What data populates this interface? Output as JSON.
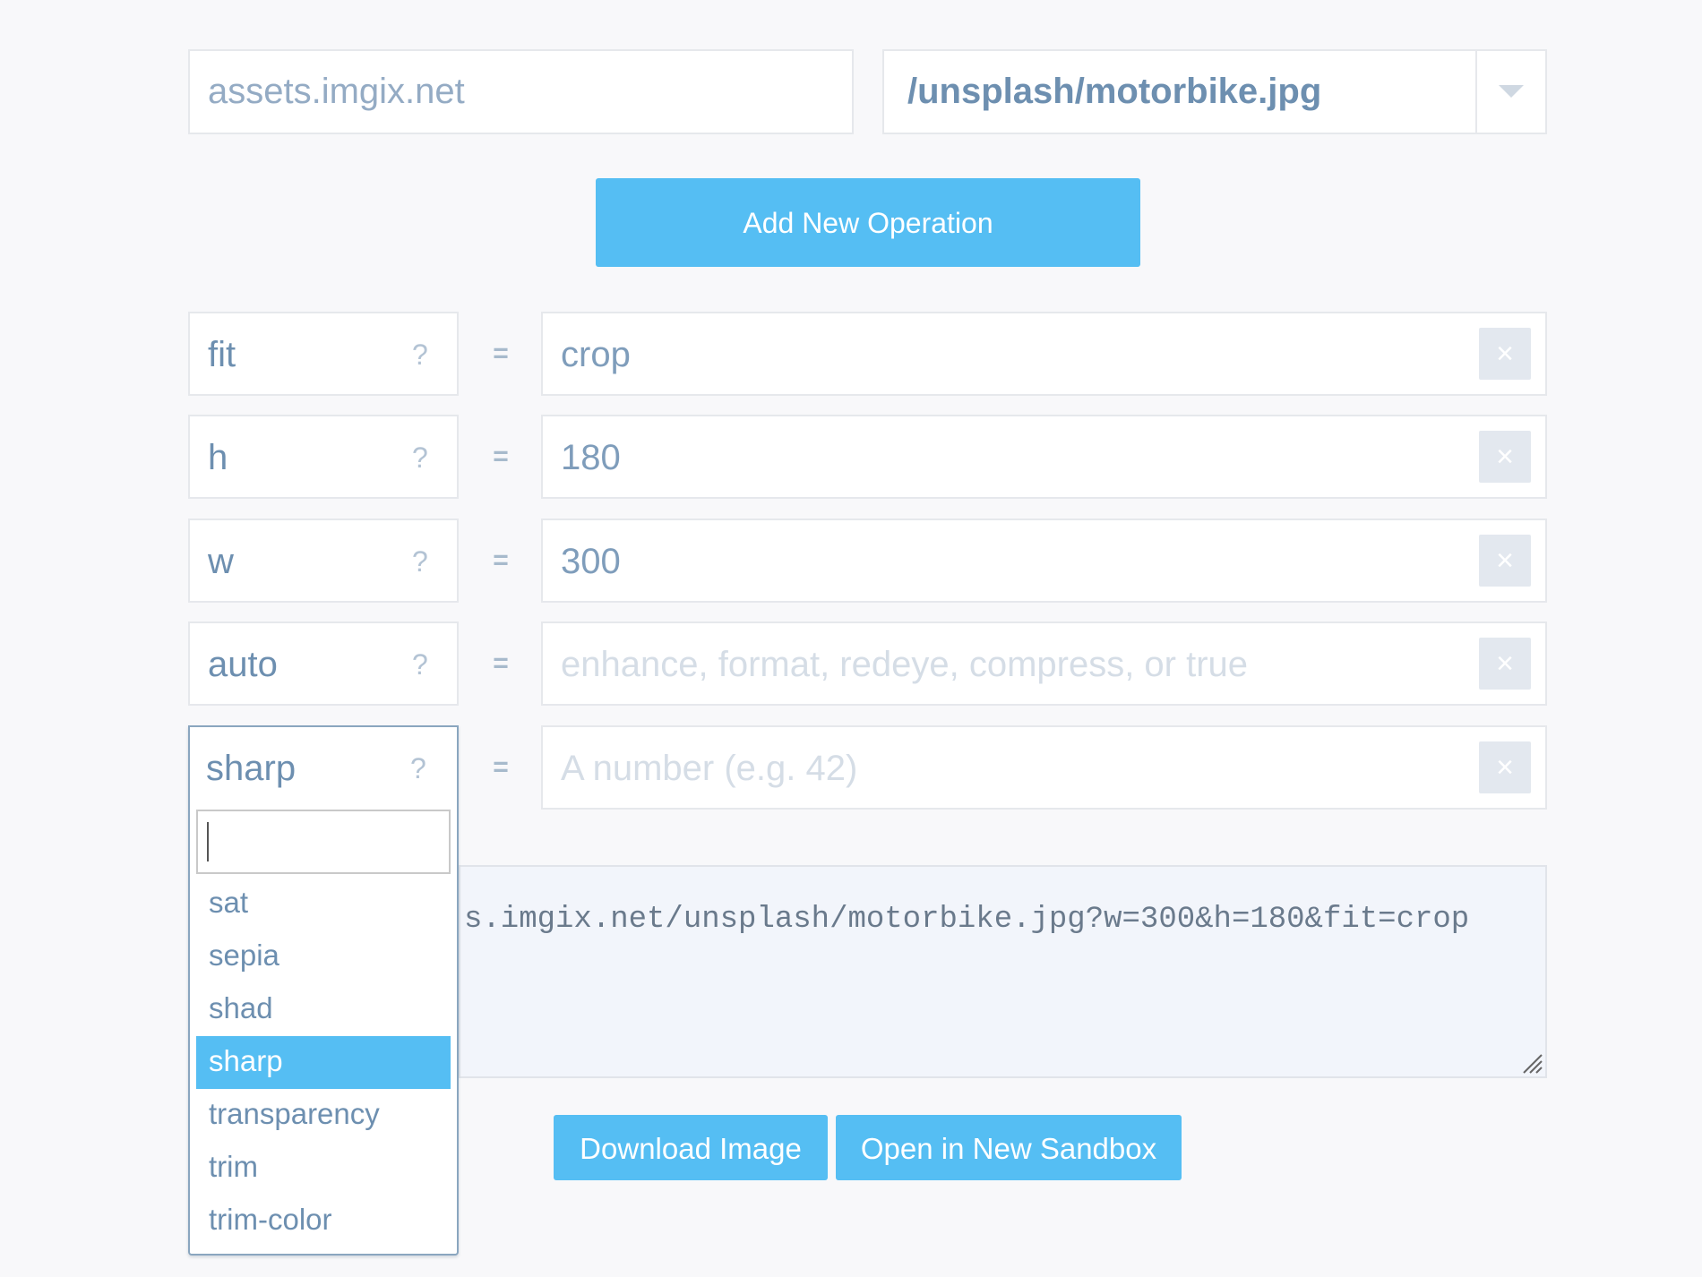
{
  "source": {
    "host_value": "assets.imgix.net",
    "path_value": "/unsplash/motorbike.jpg"
  },
  "toolbar": {
    "add_operation_label": "Add New Operation"
  },
  "operations": [
    {
      "key": "fit",
      "help": "?",
      "equals": "=",
      "value": "crop",
      "placeholder": "",
      "remove": "×"
    },
    {
      "key": "h",
      "help": "?",
      "equals": "=",
      "value": "180",
      "placeholder": "",
      "remove": "×"
    },
    {
      "key": "w",
      "help": "?",
      "equals": "=",
      "value": "300",
      "placeholder": "",
      "remove": "×"
    },
    {
      "key": "auto",
      "help": "?",
      "equals": "=",
      "value": "",
      "placeholder": "enhance, format, redeye, compress, or true",
      "remove": "×"
    },
    {
      "key": "sharp",
      "help": "?",
      "equals": "=",
      "value": "",
      "placeholder": "A number (e.g. 42)",
      "remove": "×"
    }
  ],
  "dropdown": {
    "search_value": "",
    "items": [
      "sat",
      "sepia",
      "shad",
      "sharp",
      "transparency",
      "trim",
      "trim-color"
    ],
    "selected": "sharp"
  },
  "output": {
    "url_visible": "s.imgix.net/unsplash/motorbike.jpg?w=300&h=180&fit=crop"
  },
  "actions": {
    "download_label": "Download Image",
    "sandbox_label": "Open in New Sandbox"
  },
  "colors": {
    "accent": "#55bef3",
    "text": "#6d8fb0",
    "background": "#f8f8fa"
  }
}
